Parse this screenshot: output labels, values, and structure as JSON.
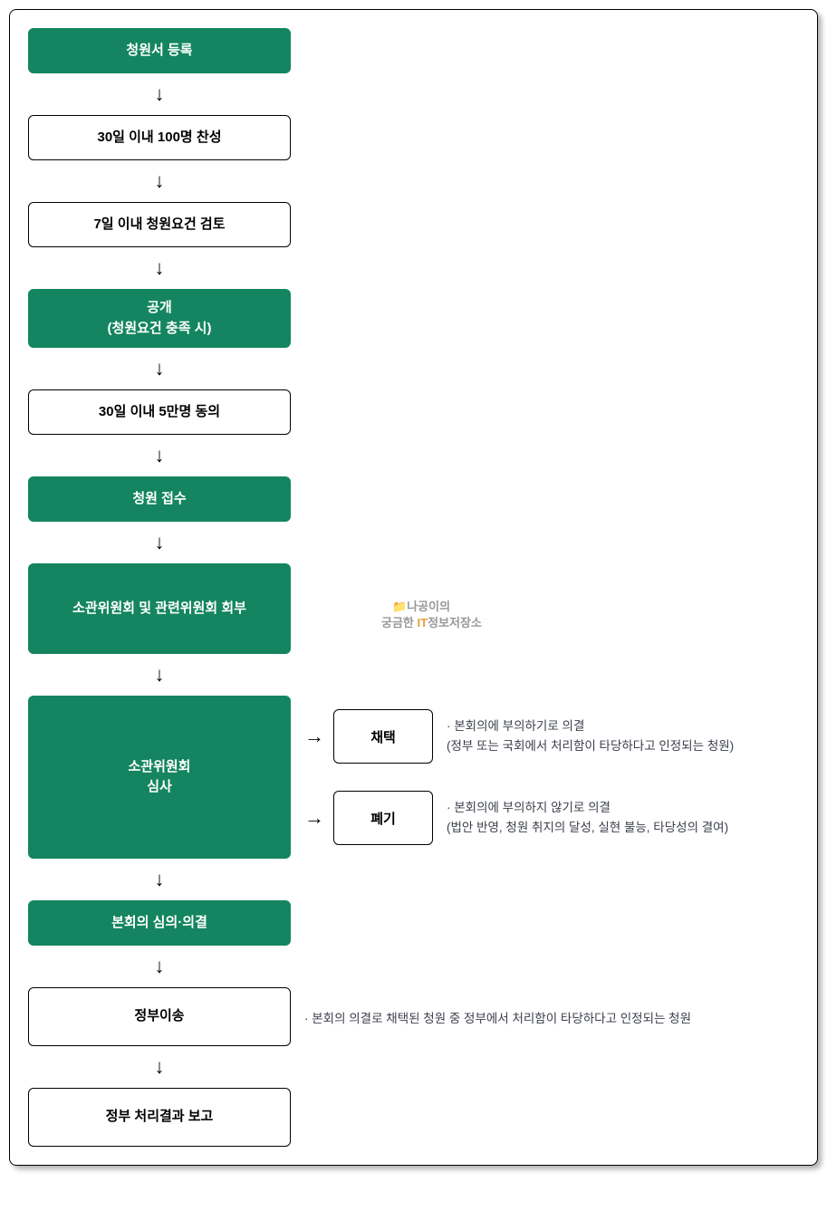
{
  "steps": {
    "s1": "청원서 등록",
    "s2": "30일 이내 100명 찬성",
    "s3": "7일 이내 청원요건 검토",
    "s4_l1": "공개",
    "s4_l2": "(청원요건 충족 시)",
    "s5": "30일 이내 5만명 동의",
    "s6": "청원 접수",
    "s7": "소관위원회 및 관련위원회 회부",
    "s8_l1": "소관위원회",
    "s8_l2": "심사",
    "s9": "본회의 심의·의결",
    "s10": "정부이송",
    "s11": "정부 처리결과 보고",
    "branch_adopt": "채택",
    "branch_discard": "폐기"
  },
  "notes": {
    "adopt_l1": "· 본회의에 부의하기로 의결",
    "adopt_l2": "  (정부 또는 국회에서 처리함이 타당하다고 인정되는 청원)",
    "discard_l1": "· 본회의에 부의하지 않기로 의결",
    "discard_l2": "  (법안 반영, 청원 취지의 달성, 실현 불능, 타당성의 결여)",
    "transfer": "· 본회의 의결로 채택된 청원 중 정부에서 처리함이 타당하다고 인정되는 청원"
  },
  "watermark": {
    "line1_pre": "",
    "line1_icon": "📁",
    "line1_text": "나공이의",
    "line2_pre": "궁금한 ",
    "line2_it": "IT",
    "line2_post": "정보저장소"
  }
}
